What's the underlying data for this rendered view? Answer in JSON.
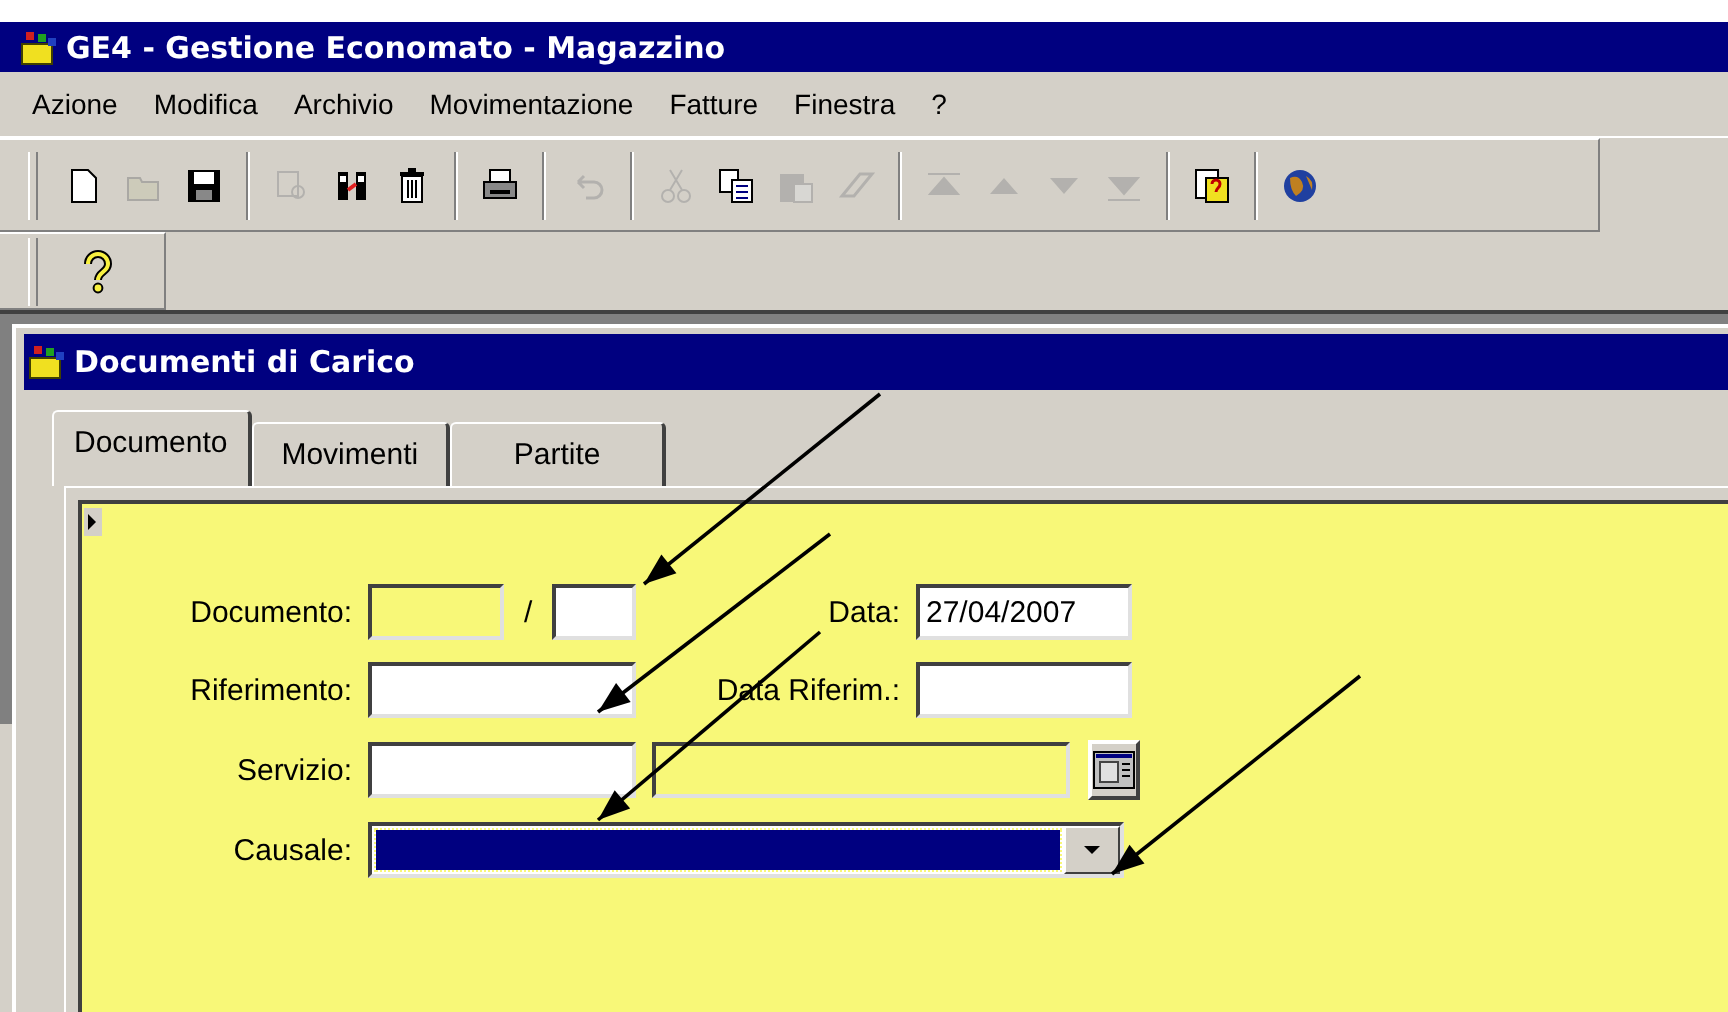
{
  "window": {
    "title": "GE4 - Gestione Economato - Magazzino"
  },
  "menu": [
    {
      "label": "Azione"
    },
    {
      "label": "Modifica"
    },
    {
      "label": "Archivio"
    },
    {
      "label": "Movimentazione"
    },
    {
      "label": "Fatture"
    },
    {
      "label": "Finestra"
    },
    {
      "label": "?"
    }
  ],
  "toolbar": [
    {
      "kind": "new",
      "disabled": false
    },
    {
      "kind": "open",
      "disabled": true
    },
    {
      "kind": "save",
      "disabled": false
    },
    {
      "kind": "sep"
    },
    {
      "kind": "find",
      "disabled": true
    },
    {
      "kind": "columns",
      "disabled": false
    },
    {
      "kind": "trash",
      "disabled": false
    },
    {
      "kind": "sep"
    },
    {
      "kind": "print",
      "disabled": false
    },
    {
      "kind": "sep"
    },
    {
      "kind": "undo",
      "disabled": true
    },
    {
      "kind": "sep"
    },
    {
      "kind": "cut",
      "disabled": true
    },
    {
      "kind": "copy",
      "disabled": false
    },
    {
      "kind": "paste",
      "disabled": true
    },
    {
      "kind": "eraser",
      "disabled": true
    },
    {
      "kind": "sep"
    },
    {
      "kind": "first",
      "disabled": true
    },
    {
      "kind": "prev",
      "disabled": true
    },
    {
      "kind": "next",
      "disabled": true
    },
    {
      "kind": "last",
      "disabled": true
    },
    {
      "kind": "sep"
    },
    {
      "kind": "helpdoc",
      "disabled": false
    },
    {
      "kind": "sep"
    },
    {
      "kind": "globe",
      "disabled": false
    }
  ],
  "toolbar2": [
    {
      "kind": "help",
      "disabled": false
    }
  ],
  "child_window": {
    "title": "Documenti di Carico"
  },
  "tabs": [
    {
      "label": "Documento",
      "selected": true
    },
    {
      "label": "Movimenti",
      "selected": false
    },
    {
      "label": "Partite",
      "selected": false
    }
  ],
  "form": {
    "documento": {
      "label": "Documento:",
      "separator": "/",
      "number": {
        "disabled": true
      },
      "year": {
        "disabled": false
      }
    },
    "data": {
      "label": "Data:",
      "value": "27/04/2007"
    },
    "riferimento": {
      "label": "Riferimento:"
    },
    "data_riferimento": {
      "label": "Data Riferim.:"
    },
    "servizio": {
      "label": "Servizio:",
      "code": {
        "disabled": false
      },
      "description": {
        "disabled": true
      }
    },
    "causale": {
      "label": "Causale:",
      "focused": true
    }
  },
  "annotations": [
    {
      "kind": "arrow"
    },
    {
      "kind": "arrow"
    },
    {
      "kind": "arrow"
    },
    {
      "kind": "arrow"
    }
  ]
}
